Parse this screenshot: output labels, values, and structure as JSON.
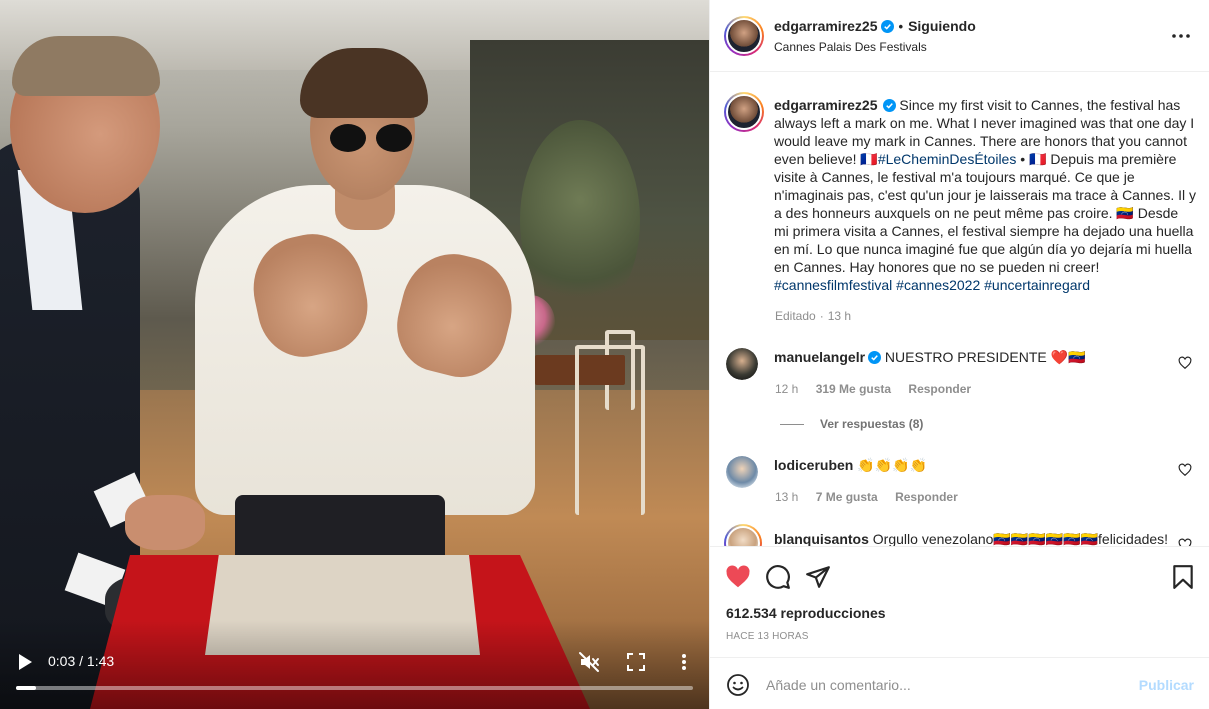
{
  "post": {
    "username": "edgarramirez25",
    "separator": "•",
    "follow_state": "Siguiendo",
    "location": "Cannes Palais Des Festivals"
  },
  "caption": {
    "username": "edgarramirez25",
    "text_en": "Since my first visit to Cannes, the festival has always left a mark on me. What I never imagined was that one day I would leave my mark in Cannes. There are honors that you cannot even believe! 🇫🇷",
    "hashtag_1": "#LeCheminDesÉtoiles",
    "text_fr": " • 🇫🇷 Depuis ma première visite à Cannes, le festival m'a toujours marqué. Ce que je n'imaginais pas, c'est qu'un jour je laisserais ma trace à Cannes. Il y a des honneurs auxquels on ne peut même pas croire. 🇻🇪 Desde mi primera visita a Cannes, el festival siempre ha dejado una huella en mí. Lo que nunca imaginé fue que algún día yo dejaría mi huella en Cannes. Hay honores que no se pueden ni creer!",
    "hashtags": [
      "#cannesfilmfestival",
      "#cannes2022",
      "#uncertainregard"
    ],
    "edited": "Editado",
    "time": "13 h"
  },
  "comments": [
    {
      "username": "manuelangelr",
      "verified": true,
      "text": "NUESTRO PRESIDENTE ❤️🇻🇪",
      "time": "12 h",
      "likes": "319 Me gusta",
      "reply": "Responder",
      "view_replies": "Ver respuestas (8)"
    },
    {
      "username": "lodiceruben",
      "verified": false,
      "text": "👏👏👏👏",
      "time": "13 h",
      "likes": "7 Me gusta",
      "reply": "Responder"
    },
    {
      "username": "blanquisantos",
      "verified": false,
      "text": "Orgullo venezolano🇻🇪🇻🇪🇻🇪🇻🇪🇻🇪🇻🇪felicidades!"
    }
  ],
  "video": {
    "current_time": "0:03",
    "duration": "1:43",
    "time_display": "0:03 / 1:43",
    "progress": 0.029
  },
  "stats": {
    "views": "612.534 reproducciones",
    "ago": "HACE 13 HORAS"
  },
  "compose": {
    "placeholder": "Añade un comentario...",
    "publish": "Publicar"
  },
  "icons": {
    "verified": "verified-badge-icon",
    "like_filled_color": "#ed4956",
    "accent": "#0095f6",
    "hashtag_color": "#00376b"
  }
}
